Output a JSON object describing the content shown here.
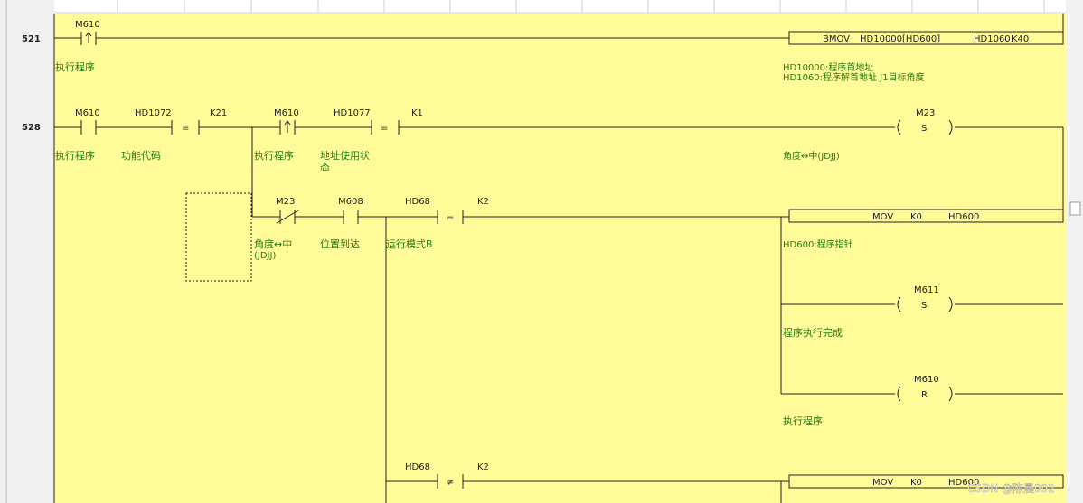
{
  "step_numbers": [
    "521",
    "528"
  ],
  "rung521": {
    "contact_m610": {
      "device": "M610",
      "comment": "执行程序"
    },
    "bmov": {
      "instr": "BMOV",
      "arg1": "HD10000[HD600]",
      "arg2": "HD1060",
      "arg3": "K40"
    },
    "bmov_comment_line1": "HD10000:程序首地址",
    "bmov_comment_line2": "HD1060:程序解首地址 J1目标角度"
  },
  "rung528": {
    "m610_a": {
      "device": "M610",
      "comment": "执行程序"
    },
    "cmp1": {
      "op": "=",
      "src1": "HD1072",
      "src2": "K21",
      "comment": "功能代码"
    },
    "m610_b": {
      "device": "M610",
      "comment": "执行程序"
    },
    "cmp2": {
      "op": "=",
      "src1": "HD1077",
      "src2": "K1",
      "comment_line1": "地址使用状",
      "comment_line2": "态"
    },
    "coil_m23": {
      "device": "M23",
      "mode": "S",
      "comment": "角度↔中(JDJJ)"
    },
    "m23_nc": {
      "device": "M23",
      "comment_line1": "角度↔中",
      "comment_line2": "(JDJJ)"
    },
    "m608": {
      "device": "M608",
      "comment": "位置到达"
    },
    "cmp3": {
      "op": "=",
      "src1": "HD68",
      "src2": "K2",
      "comment": "运行模式B"
    },
    "mov1": {
      "instr": "MOV",
      "src": "K0",
      "dst": "HD600",
      "comment": "HD600:程序指针"
    },
    "coil_m611": {
      "device": "M611",
      "mode": "S",
      "comment": "程序执行完成"
    },
    "coil_m610": {
      "device": "M610",
      "mode": "R",
      "comment": "执行程序"
    },
    "cmp4": {
      "op": "≠",
      "src1": "HD68",
      "src2": "K2"
    },
    "mov2": {
      "instr": "MOV",
      "src": "K0",
      "dst": "HD600"
    }
  },
  "watermark": "CSDN @陈晨992",
  "colors": {
    "rung_bg": "#fffb99",
    "comment_text": "#2a7a12",
    "line": "#222222",
    "step_column": "#f0f0f0"
  }
}
